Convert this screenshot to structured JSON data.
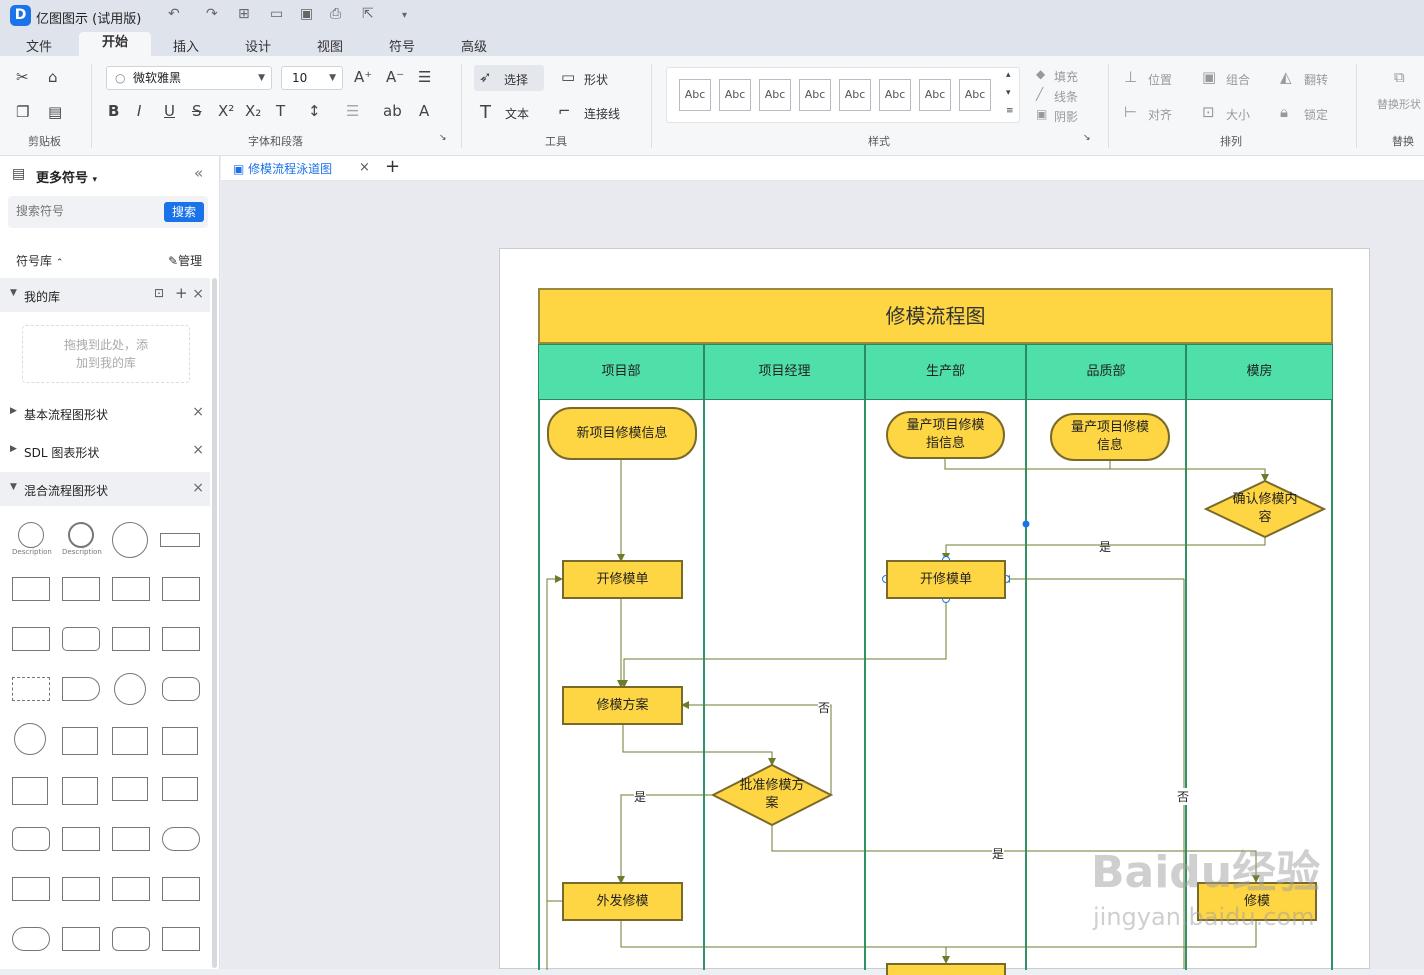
{
  "app": {
    "title": "亿图图示 (试用版)",
    "logo": "D"
  },
  "menu_tabs": [
    "文件",
    "开始",
    "插入",
    "设计",
    "视图",
    "符号",
    "高级"
  ],
  "ribbon": {
    "groups": {
      "clipboard": "剪贴板",
      "font": "字体和段落",
      "tools": "工具",
      "style": "样式",
      "arrange": "排列",
      "replace": "替换"
    },
    "font_name": "微软雅黑",
    "font_size": "10",
    "tools": {
      "select": "选择",
      "shape": "形状",
      "text": "文本",
      "connector": "连接线"
    },
    "style_samples": [
      "Abc",
      "Abc",
      "Abc",
      "Abc",
      "Abc",
      "Abc",
      "Abc",
      "Abc"
    ],
    "style_opts": {
      "fill": "填充",
      "line": "线条",
      "shadow": "阴影"
    },
    "arrange": {
      "position": "位置",
      "group": "组合",
      "flip": "翻转",
      "align": "对齐",
      "size": "大小",
      "lock": "锁定",
      "replace_shape": "替换形状"
    }
  },
  "sidebar": {
    "header": "更多符号",
    "search_placeholder": "搜索符号",
    "search_button": "搜索",
    "library_label": "符号库",
    "manage": "管理",
    "my_lib": "我的库",
    "drop_hint_1": "拖拽到此处，添",
    "drop_hint_2": "加到我的库",
    "libs": [
      "基本流程图形状",
      "SDL 图表形状",
      "混合流程图形状"
    ],
    "shape_desc_1": "Description",
    "shape_desc_2": "Description"
  },
  "document": {
    "tab_name": "修模流程泳道图"
  },
  "diagram": {
    "title": "修模流程图",
    "lanes": [
      "项目部",
      "项目经理",
      "生产部",
      "品质部",
      "模房"
    ],
    "nodes": {
      "n1": "新项目修模信息",
      "n2a": "量产项目修模",
      "n2b": "指信息",
      "n3a": "量产项目修模",
      "n3b": "信息",
      "n4a": "确认修模内",
      "n4b": "容",
      "n5": "开修模单",
      "n6": "开修模单",
      "n7": "修模方案",
      "n8a": "批准修模方",
      "n8b": "案",
      "n9": "外发修模",
      "n10": "修模"
    },
    "labels": {
      "yes1": "是",
      "no1": "否",
      "yes2": "是",
      "yes3": "是",
      "no2": "否"
    }
  },
  "watermark": {
    "line1": "Baidu经验",
    "line2": "jingyan.baidu.com"
  },
  "colors": {
    "accent": "#1a73e8",
    "lane_header": "#4fdfa9",
    "node_fill": "#fed542",
    "connector": "#6b7d2c"
  }
}
